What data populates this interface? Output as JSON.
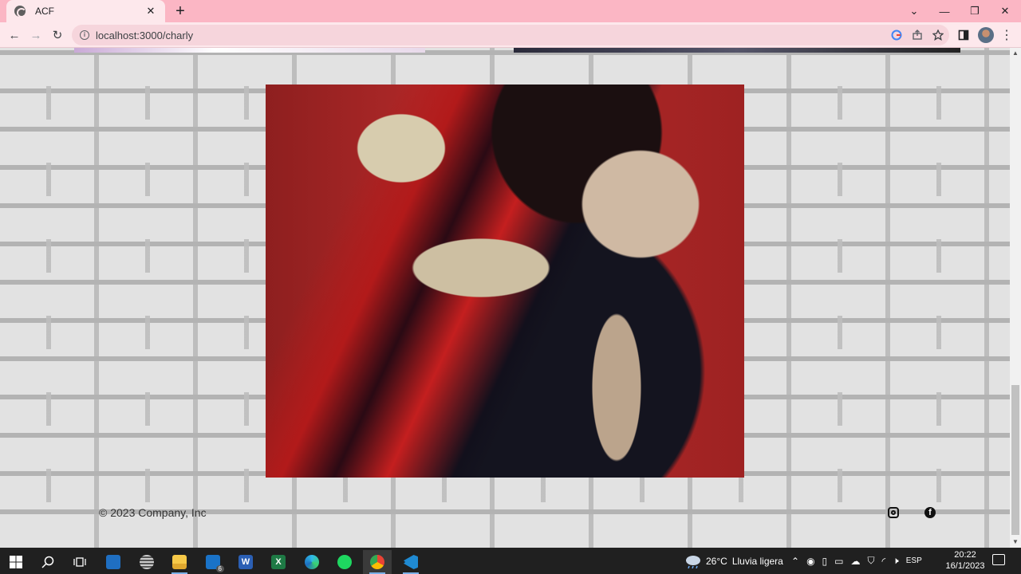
{
  "browser": {
    "tab_title": "ACF",
    "tab_close": "✕",
    "new_tab": "+",
    "url": "localhost:3000/charly",
    "window_controls": {
      "minimize": "—",
      "maximize": "❐",
      "close": "✕",
      "tab_search": "⌄"
    },
    "nav": {
      "back": "←",
      "forward": "→",
      "reload": "↻"
    },
    "toolbar_icons": [
      "google-lens-icon",
      "share-icon",
      "star-icon",
      "side-panel-icon",
      "profile-avatar",
      "menu-icon"
    ]
  },
  "page": {
    "hero_image": "charly-garcia-portrait",
    "footer": {
      "copyright": "© 2023 Company, Inc",
      "social": [
        "instagram-icon",
        "facebook-icon"
      ],
      "facebook_glyph": "f"
    }
  },
  "taskbar": {
    "apps": [
      "start",
      "search",
      "task-view",
      "dev-app",
      "disk-app",
      "file-explorer",
      "mail",
      "word",
      "excel",
      "edge",
      "spotify",
      "chrome",
      "vscode"
    ],
    "mail_badge": "6",
    "weather_temp": "26°C",
    "weather_desc": "Lluvia ligera",
    "language": "ESP",
    "time": "20:22",
    "date": "16/1/2023"
  }
}
